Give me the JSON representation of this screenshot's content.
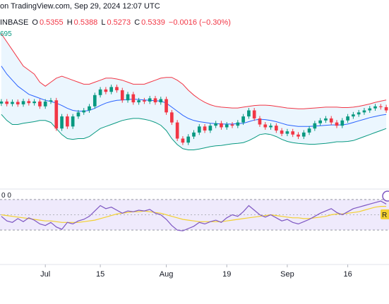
{
  "header": {
    "published_text": "on TradingView.com, Sep 29, 2024 12:07 UTC",
    "symbol_fragment": "INBASE",
    "open_label": "O",
    "open_value": "0.5355",
    "high_label": "H",
    "high_value": "0.5388",
    "low_label": "L",
    "low_value": "0.5273",
    "close_label": "C",
    "close_value": "0.5339",
    "change_text": "−0.0016 (−0.30%)",
    "bb_fragment": "695"
  },
  "rsi_panel": {
    "label_fragment": "0 0",
    "badge_fragment": "R"
  },
  "colors": {
    "bb_upper": "#f23645",
    "bb_basis": "#2962ff",
    "bb_lower": "#089981",
    "bb_fill": "#e3f2fd",
    "candle_up": "#089981",
    "candle_down": "#f23645",
    "rsi_line": "#7e57c2",
    "rsi_ma": "#f3d030",
    "rsi_band": "#efeafc"
  },
  "chart_data": [
    {
      "type": "candlestick",
      "title": "",
      "x_tick_labels": [
        "Jul",
        "15",
        "Aug",
        "19",
        "Sep",
        "16"
      ],
      "x_tick_index": [
        8,
        18,
        30,
        41,
        52,
        63
      ],
      "ylim": [
        0.4,
        0.78
      ],
      "candles": [
        {
          "o": 0.607,
          "c": 0.612
        },
        {
          "o": 0.612,
          "c": 0.606
        },
        {
          "o": 0.606,
          "c": 0.611
        },
        {
          "o": 0.611,
          "c": 0.605
        },
        {
          "o": 0.605,
          "c": 0.613
        },
        {
          "o": 0.613,
          "c": 0.608
        },
        {
          "o": 0.608,
          "c": 0.612
        },
        {
          "o": 0.612,
          "c": 0.6
        },
        {
          "o": 0.6,
          "c": 0.612
        },
        {
          "o": 0.612,
          "c": 0.615
        },
        {
          "o": 0.615,
          "c": 0.545
        },
        {
          "o": 0.545,
          "c": 0.575
        },
        {
          "o": 0.575,
          "c": 0.55
        },
        {
          "o": 0.55,
          "c": 0.575
        },
        {
          "o": 0.575,
          "c": 0.585
        },
        {
          "o": 0.585,
          "c": 0.59
        },
        {
          "o": 0.59,
          "c": 0.6
        },
        {
          "o": 0.6,
          "c": 0.628
        },
        {
          "o": 0.628,
          "c": 0.642
        },
        {
          "o": 0.642,
          "c": 0.636
        },
        {
          "o": 0.636,
          "c": 0.648
        },
        {
          "o": 0.648,
          "c": 0.64
        },
        {
          "o": 0.64,
          "c": 0.615
        },
        {
          "o": 0.615,
          "c": 0.63
        },
        {
          "o": 0.63,
          "c": 0.61
        },
        {
          "o": 0.61,
          "c": 0.615
        },
        {
          "o": 0.615,
          "c": 0.612
        },
        {
          "o": 0.612,
          "c": 0.62
        },
        {
          "o": 0.62,
          "c": 0.61
        },
        {
          "o": 0.61,
          "c": 0.618
        },
        {
          "o": 0.618,
          "c": 0.585
        },
        {
          "o": 0.585,
          "c": 0.56
        },
        {
          "o": 0.56,
          "c": 0.52
        },
        {
          "o": 0.52,
          "c": 0.51
        },
        {
          "o": 0.51,
          "c": 0.525
        },
        {
          "o": 0.525,
          "c": 0.535
        },
        {
          "o": 0.535,
          "c": 0.55
        },
        {
          "o": 0.55,
          "c": 0.54
        },
        {
          "o": 0.54,
          "c": 0.552
        },
        {
          "o": 0.552,
          "c": 0.558
        },
        {
          "o": 0.558,
          "c": 0.548
        },
        {
          "o": 0.548,
          "c": 0.555
        },
        {
          "o": 0.555,
          "c": 0.552
        },
        {
          "o": 0.552,
          "c": 0.56
        },
        {
          "o": 0.56,
          "c": 0.575
        },
        {
          "o": 0.575,
          "c": 0.59
        },
        {
          "o": 0.59,
          "c": 0.57
        },
        {
          "o": 0.57,
          "c": 0.555
        },
        {
          "o": 0.555,
          "c": 0.548
        },
        {
          "o": 0.548,
          "c": 0.552
        },
        {
          "o": 0.552,
          "c": 0.54
        },
        {
          "o": 0.54,
          "c": 0.532
        },
        {
          "o": 0.532,
          "c": 0.538
        },
        {
          "o": 0.538,
          "c": 0.53
        },
        {
          "o": 0.53,
          "c": 0.525
        },
        {
          "o": 0.525,
          "c": 0.535
        },
        {
          "o": 0.535,
          "c": 0.545
        },
        {
          "o": 0.545,
          "c": 0.558
        },
        {
          "o": 0.558,
          "c": 0.565
        },
        {
          "o": 0.565,
          "c": 0.57
        },
        {
          "o": 0.57,
          "c": 0.56
        },
        {
          "o": 0.56,
          "c": 0.552
        },
        {
          "o": 0.552,
          "c": 0.565
        },
        {
          "o": 0.565,
          "c": 0.575
        },
        {
          "o": 0.575,
          "c": 0.58
        },
        {
          "o": 0.58,
          "c": 0.585
        },
        {
          "o": 0.585,
          "c": 0.59
        },
        {
          "o": 0.59,
          "c": 0.595
        },
        {
          "o": 0.595,
          "c": 0.6
        },
        {
          "o": 0.6,
          "c": 0.598
        },
        {
          "o": 0.598,
          "c": 0.59
        }
      ],
      "bb_upper": [
        0.78,
        0.76,
        0.74,
        0.72,
        0.7,
        0.69,
        0.68,
        0.66,
        0.65,
        0.66,
        0.67,
        0.675,
        0.67,
        0.665,
        0.66,
        0.655,
        0.655,
        0.66,
        0.665,
        0.67,
        0.67,
        0.668,
        0.665,
        0.66,
        0.655,
        0.655,
        0.655,
        0.66,
        0.665,
        0.67,
        0.672,
        0.672,
        0.665,
        0.655,
        0.64,
        0.628,
        0.618,
        0.61,
        0.604,
        0.6,
        0.598,
        0.597,
        0.596,
        0.596,
        0.598,
        0.6,
        0.602,
        0.603,
        0.603,
        0.602,
        0.6,
        0.598,
        0.596,
        0.595,
        0.594,
        0.594,
        0.595,
        0.596,
        0.597,
        0.598,
        0.598,
        0.598,
        0.597,
        0.597,
        0.598,
        0.6,
        0.603,
        0.606,
        0.61,
        0.613,
        0.616
      ],
      "bb_basis": [
        0.7,
        0.68,
        0.665,
        0.65,
        0.64,
        0.63,
        0.625,
        0.62,
        0.615,
        0.612,
        0.608,
        0.602,
        0.595,
        0.59,
        0.588,
        0.588,
        0.59,
        0.595,
        0.602,
        0.608,
        0.612,
        0.615,
        0.616,
        0.617,
        0.618,
        0.617,
        0.616,
        0.615,
        0.614,
        0.613,
        0.608,
        0.598,
        0.588,
        0.578,
        0.57,
        0.565,
        0.562,
        0.56,
        0.558,
        0.557,
        0.556,
        0.556,
        0.556,
        0.557,
        0.558,
        0.562,
        0.566,
        0.568,
        0.567,
        0.565,
        0.562,
        0.558,
        0.554,
        0.552,
        0.55,
        0.55,
        0.55,
        0.551,
        0.552,
        0.553,
        0.554,
        0.554,
        0.554,
        0.556,
        0.56,
        0.564,
        0.568,
        0.572,
        0.575,
        0.578,
        0.58
      ],
      "bb_lower": [
        0.58,
        0.565,
        0.555,
        0.555,
        0.558,
        0.56,
        0.562,
        0.565,
        0.565,
        0.56,
        0.545,
        0.53,
        0.52,
        0.518,
        0.52,
        0.52,
        0.525,
        0.535,
        0.545,
        0.55,
        0.555,
        0.56,
        0.565,
        0.568,
        0.57,
        0.57,
        0.568,
        0.565,
        0.56,
        0.553,
        0.54,
        0.52,
        0.505,
        0.495,
        0.492,
        0.492,
        0.494,
        0.497,
        0.5,
        0.502,
        0.503,
        0.505,
        0.507,
        0.508,
        0.51,
        0.515,
        0.522,
        0.53,
        0.532,
        0.53,
        0.525,
        0.518,
        0.513,
        0.51,
        0.508,
        0.507,
        0.506,
        0.506,
        0.507,
        0.508,
        0.51,
        0.512,
        0.512,
        0.513,
        0.515,
        0.52,
        0.525,
        0.53,
        0.535,
        0.54,
        0.545
      ]
    },
    {
      "type": "line",
      "title": "",
      "ylim": [
        20,
        80
      ],
      "series": [
        {
          "name": "",
          "values": [
            48,
            42,
            40,
            45,
            41,
            46,
            43,
            38,
            36,
            40,
            34,
            31,
            40,
            38,
            42,
            44,
            48,
            55,
            62,
            58,
            60,
            56,
            52,
            55,
            54,
            56,
            55,
            57,
            52,
            50,
            44,
            36,
            30,
            29,
            32,
            35,
            40,
            38,
            41,
            43,
            40,
            46,
            50,
            48,
            54,
            62,
            56,
            50,
            47,
            50,
            46,
            42,
            44,
            40,
            38,
            41,
            44,
            48,
            52,
            55,
            58,
            53,
            50,
            54,
            58,
            60,
            62,
            64,
            66,
            68,
            64
          ]
        },
        {
          "name": "",
          "values": [
            50,
            49,
            48,
            47,
            46,
            45,
            44,
            43,
            42,
            42,
            41,
            40,
            40,
            40,
            40,
            41,
            42,
            43,
            45,
            47,
            49,
            51,
            52,
            53,
            54,
            54,
            55,
            54,
            53,
            52,
            50,
            48,
            46,
            44,
            43,
            42,
            41,
            41,
            41,
            41,
            41,
            42,
            43,
            44,
            45,
            46,
            47,
            48,
            49,
            50,
            49,
            48,
            47,
            46,
            46,
            45,
            45,
            46,
            47,
            48,
            50,
            51,
            51,
            52,
            53,
            54,
            56,
            58,
            60,
            61,
            61
          ]
        }
      ]
    }
  ]
}
